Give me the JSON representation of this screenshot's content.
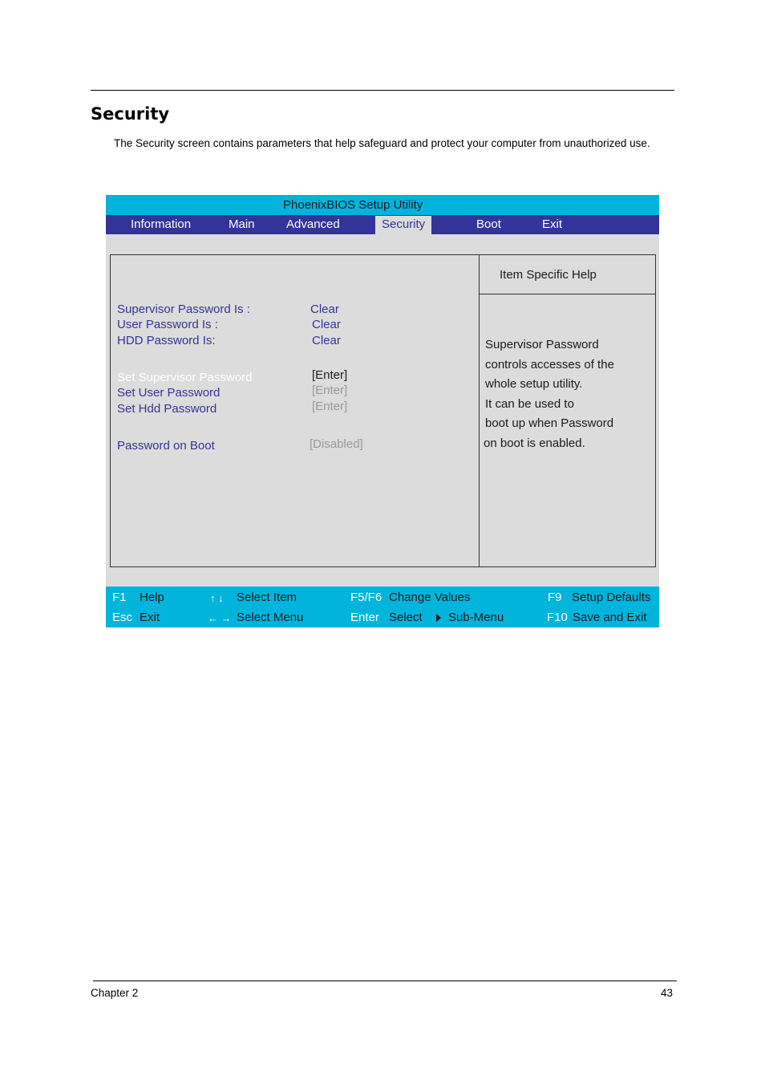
{
  "document": {
    "heading": "Security",
    "intro": "The Security screen contains parameters that help safeguard and protect your computer from unauthorized use.",
    "footer": {
      "chapter": "Chapter 2",
      "page_number": "43"
    }
  },
  "bios": {
    "title": "PhoenixBIOS Setup Utility",
    "menu": [
      {
        "label": "Information",
        "active": false
      },
      {
        "label": "Main",
        "active": false
      },
      {
        "label": "Advanced",
        "active": false
      },
      {
        "label": "Security",
        "active": true
      },
      {
        "label": "Boot",
        "active": false
      },
      {
        "label": "Exit",
        "active": false
      }
    ],
    "colors": {
      "title_bar": "#00b4dc",
      "menu_bar": "#333399",
      "panel_bg": "#dcdcdc",
      "item_text": "#333399",
      "disabled_value": "#999999",
      "selected_item": "#ffffff"
    },
    "status": [
      {
        "label": "Supervisor Password Is :",
        "value": "Clear"
      },
      {
        "label": "User Password Is :",
        "value": "Clear"
      },
      {
        "label": "HDD Password Is:",
        "value": "Clear"
      }
    ],
    "settings": [
      {
        "label": "Set Supervisor Password",
        "value": "[Enter]",
        "selected": true
      },
      {
        "label": "Set User Password",
        "value": "[Enter]",
        "selected": false
      },
      {
        "label": "Set Hdd Password",
        "value": "[Enter]",
        "selected": false
      },
      {
        "label": "Password on Boot",
        "value": "[Disabled]",
        "selected": false
      }
    ],
    "help": {
      "title": "Item Specific Help",
      "lines": [
        "Supervisor Password",
        "controls accesses of the",
        "whole setup utility.",
        "It can be used to",
        "boot up when Password",
        "on boot is enabled."
      ]
    },
    "keys": [
      {
        "key": "F1",
        "desc": "Help"
      },
      {
        "key": "Esc",
        "desc": "Exit"
      },
      {
        "key": "↑ ↓",
        "desc": "Select Item"
      },
      {
        "key": "← →",
        "desc": "Select Menu"
      },
      {
        "key": "F5/F6",
        "desc": "Change Values"
      },
      {
        "key": "Enter",
        "desc": "Select",
        "extra": "Sub-Menu"
      },
      {
        "key": "F9",
        "desc": "Setup Defaults"
      },
      {
        "key": "F10",
        "desc": "Save and Exit"
      }
    ]
  }
}
